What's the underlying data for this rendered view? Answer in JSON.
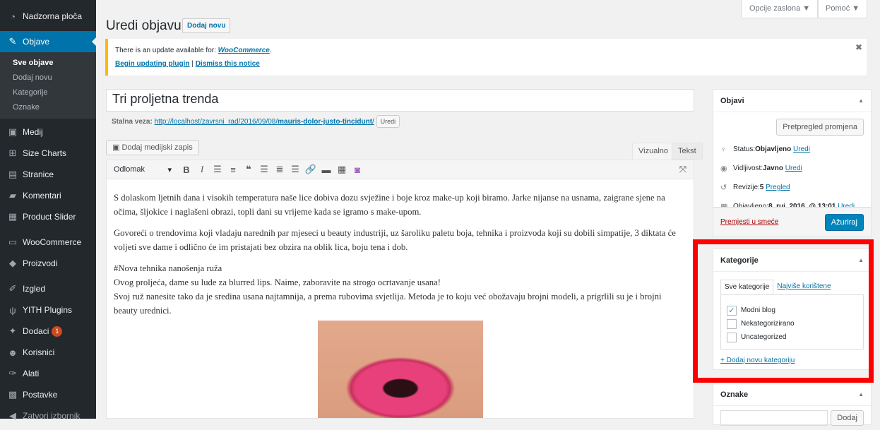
{
  "sidebar": {
    "items": [
      {
        "label": "Nadzorna ploča",
        "icon": "dashboard-icon"
      },
      {
        "label": "Objave",
        "icon": "pin-icon"
      },
      {
        "label": "Medij",
        "icon": "media-icon"
      },
      {
        "label": "Size Charts",
        "icon": "grid-icon"
      },
      {
        "label": "Stranice",
        "icon": "page-icon"
      },
      {
        "label": "Komentari",
        "icon": "comment-icon"
      },
      {
        "label": "Product Slider",
        "icon": "slider-icon"
      },
      {
        "label": "WooCommerce",
        "icon": "woo-icon"
      },
      {
        "label": "Proizvodi",
        "icon": "box-icon"
      },
      {
        "label": "Izgled",
        "icon": "brush-icon"
      },
      {
        "label": "YITH Plugins",
        "icon": "yith-icon"
      },
      {
        "label": "Dodaci",
        "icon": "plugin-icon",
        "badge": "1"
      },
      {
        "label": "Korisnici",
        "icon": "users-icon"
      },
      {
        "label": "Alati",
        "icon": "wrench-icon"
      },
      {
        "label": "Postavke",
        "icon": "settings-icon"
      },
      {
        "label": "Zatvori izbornik",
        "icon": "collapse-icon"
      }
    ],
    "submenu": [
      "Sve objave",
      "Dodaj novu",
      "Kategorije",
      "Oznake"
    ]
  },
  "header": {
    "screen_options": "Opcije zaslona ▼",
    "help": "Pomoć ▼",
    "title": "Uredi objavu",
    "add_new": "Dodaj novu"
  },
  "notice": {
    "text": "There is an update available for: ",
    "plugin": "WooCommerce",
    "update": "Begin updating plugin",
    "sep": " | ",
    "dismiss": "Dismiss this notice"
  },
  "post": {
    "title": "Tri proljetna trenda",
    "permalink_label": "Stalna veza:",
    "permalink_base": "http://localhost/zavrsni_rad/2016/09/08/",
    "permalink_slug": "mauris-dolor-justo-tincidunt",
    "permalink_end": "/",
    "permalink_edit": "Uredi",
    "add_media": "Dodaj medijski zapis",
    "tab_visual": "Vizualno",
    "tab_text": "Tekst",
    "format": "Odlomak",
    "paragraphs": [
      "S dolaskom ljetnih dana i visokih temperatura naše lice dobiva dozu svježine i boje kroz make-up koji biramo. Jarke nijanse na usnama, zaigrane sjene na očima, šljokice i naglašeni obrazi, topli dani su vrijeme kada se igramo s make-upom.",
      "Govoreći o trendovima koji vladaju narednih par mjeseci u beauty industriji, uz šaroliku paletu boja, tehnika i proizvoda koji su dobili simpatije, 3 diktata će voljeti sve dame i odlično će im pristajati bez obzira na oblik lica, boju tena i dob."
    ],
    "p3_line1": "#Nova tehnika nanošenja ruža",
    "p3_line2": "Ovog proljeća, dame su lude za blurred lips. Naime, zaboravite na strogo ocrtavanje usana!",
    "p3_line3": "Svoj ruž nanesite tako da je sredina usana najtamnija, a prema rubovima svjetlija. Metoda je to koju već obožavaju brojni modeli, a prigrlili su je i brojni beauty urednici."
  },
  "publish": {
    "title": "Objavi",
    "preview": "Pretpregled promjena",
    "status_label": "Status: ",
    "status_value": "Objavljeno",
    "status_edit": "Uredi",
    "visibility_label": "Vidljivost: ",
    "visibility_value": "Javno",
    "visibility_edit": "Uredi",
    "revisions_label": "Revizije: ",
    "revisions_value": "5",
    "revisions_link": "Pregled",
    "published_label": "Objavljeno: ",
    "published_value": "8. ruj. 2016. @ 13:01",
    "published_edit": "Uredi",
    "trash": "Premjesti u smeće",
    "update": "Ažuriraj"
  },
  "categories": {
    "title": "Kategorije",
    "tab_all": "Sve kategorije",
    "tab_popular": "Najviše korištene",
    "items": [
      {
        "label": "Modni blog",
        "checked": true
      },
      {
        "label": "Nekategorizirano",
        "checked": false
      },
      {
        "label": "Uncategorized",
        "checked": false
      }
    ],
    "add_new": "+ Dodaj novu kategoriju"
  },
  "tags": {
    "title": "Oznake",
    "add": "Dodaj"
  },
  "colors": {
    "highlight": "#ff0000",
    "accent": "#0073aa"
  }
}
